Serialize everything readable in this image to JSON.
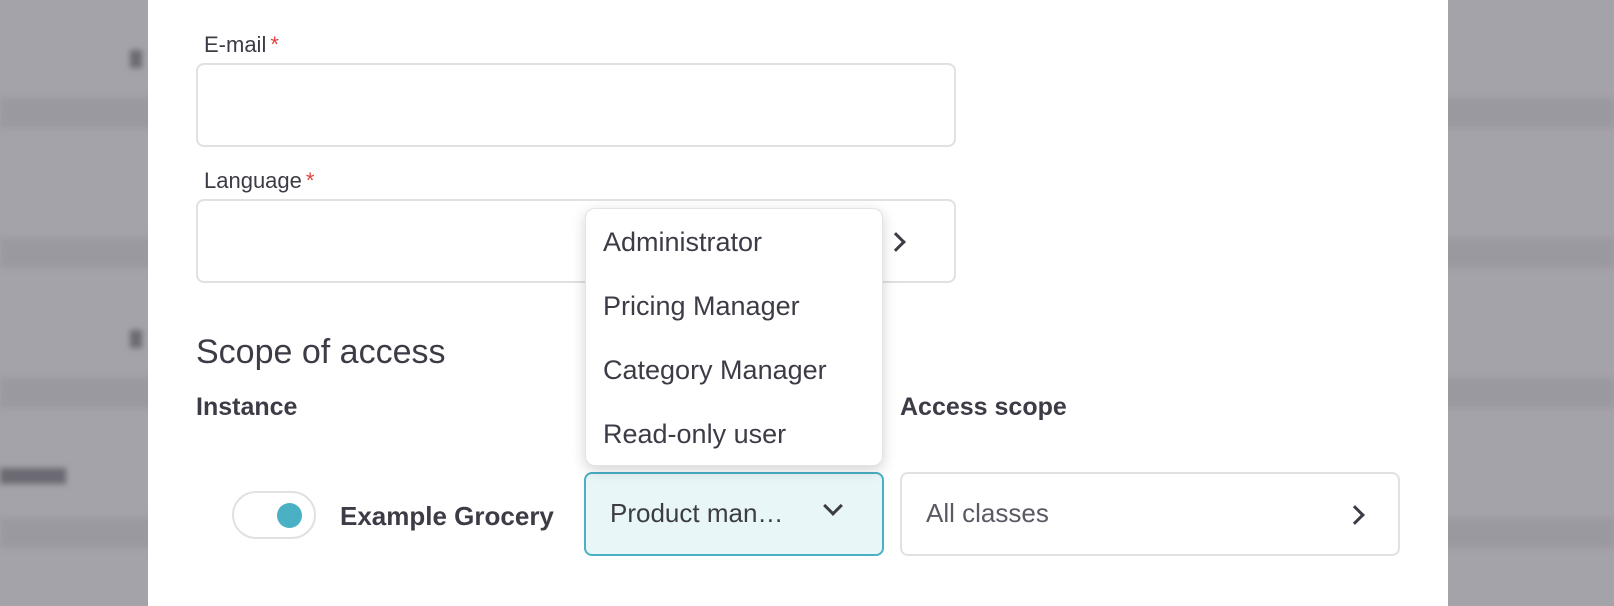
{
  "form": {
    "email": {
      "label": "E-mail",
      "required_mark": "*",
      "value": ""
    },
    "language": {
      "label": "Language",
      "required_mark": "*",
      "value": "",
      "icon": "chevron-right-icon"
    }
  },
  "scope": {
    "title": "Scope of access",
    "columns": {
      "instance": "Instance",
      "access_scope": "Access scope"
    },
    "row": {
      "toggle_on": true,
      "instance_name": "Example Grocery",
      "role_value": "Product man…",
      "role_icon": "chevron-down-icon",
      "access_value": "All classes",
      "access_icon": "chevron-right-icon"
    }
  },
  "role_dropdown": {
    "options": [
      "Administrator",
      "Pricing Manager",
      "Category Manager",
      "Read-only user"
    ]
  },
  "colors": {
    "accent": "#4ab0c4",
    "required": "#e0433f",
    "text": "#3c3c46",
    "border": "#e1e1e4",
    "selected_bg": "#e8f6f8"
  }
}
